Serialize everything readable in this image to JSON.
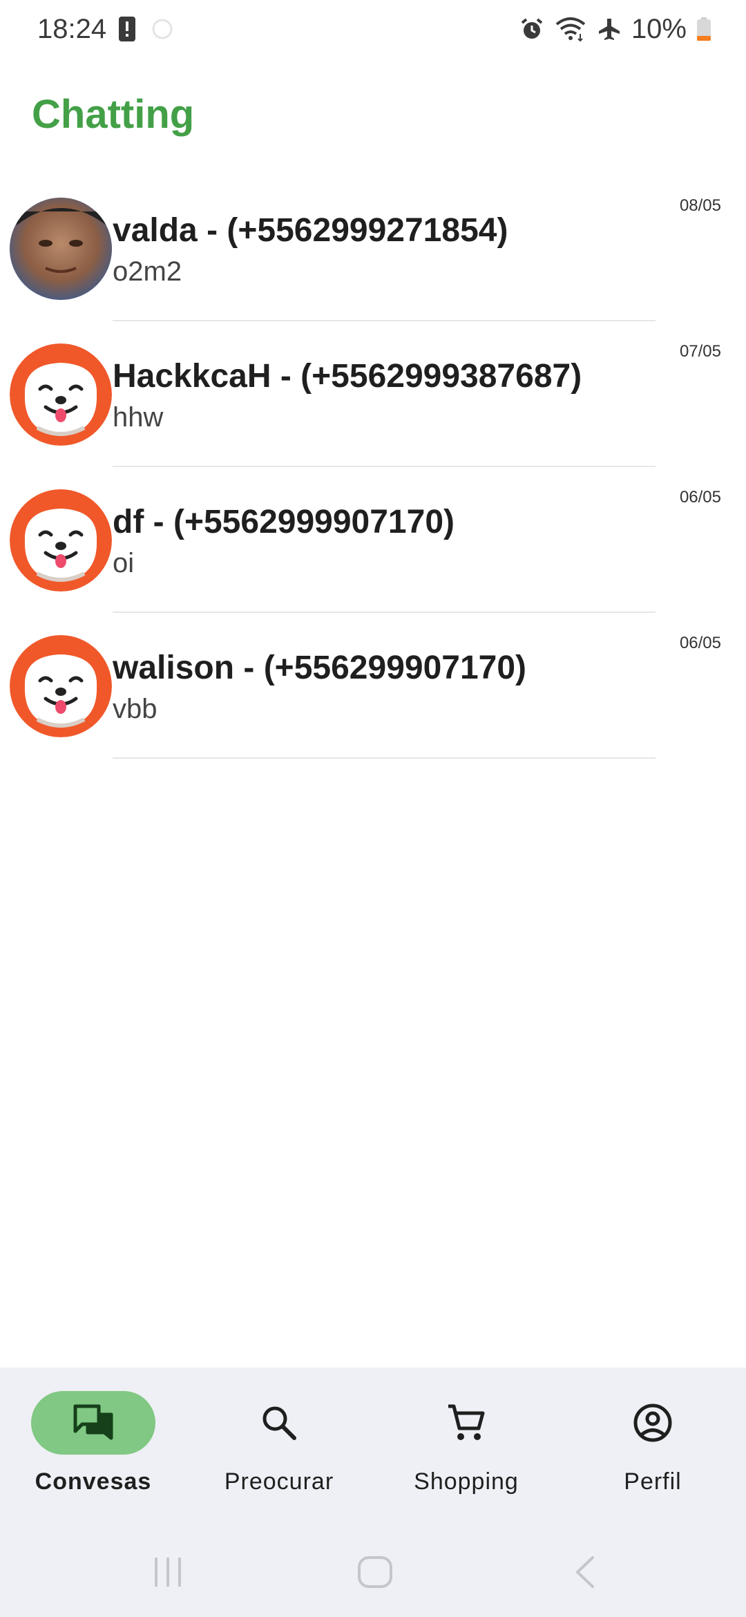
{
  "status_bar": {
    "time": "18:24",
    "battery": "10%",
    "icons": [
      "alert-icon",
      "alarm-icon",
      "wifi-icon",
      "airplane-icon",
      "battery-icon"
    ]
  },
  "app": {
    "title": "Chatting",
    "accent_color": "#43a047"
  },
  "chats": [
    {
      "name": "valda - (+5562999271854)",
      "preview": "o2m2",
      "date": "08/05",
      "avatar": "photo"
    },
    {
      "name": "HackkcaH - (+5562999387687)",
      "preview": "hhw",
      "date": "07/05",
      "avatar": "dog"
    },
    {
      "name": "df - (+5562999907170)",
      "preview": "oi",
      "date": "06/05",
      "avatar": "dog"
    },
    {
      "name": "walison - (+556299907170)",
      "preview": "vbb",
      "date": "06/05",
      "avatar": "dog"
    }
  ],
  "bottom_nav": {
    "active_color": "#80c883",
    "items": [
      {
        "label": "Convesas",
        "icon": "chat-icon",
        "active": true
      },
      {
        "label": "Preocurar",
        "icon": "search-icon",
        "active": false
      },
      {
        "label": "Shopping",
        "icon": "cart-icon",
        "active": false
      },
      {
        "label": "Perfil",
        "icon": "profile-icon",
        "active": false
      }
    ]
  },
  "system_nav": {
    "buttons": [
      "recents-icon",
      "home-icon",
      "back-icon"
    ]
  }
}
